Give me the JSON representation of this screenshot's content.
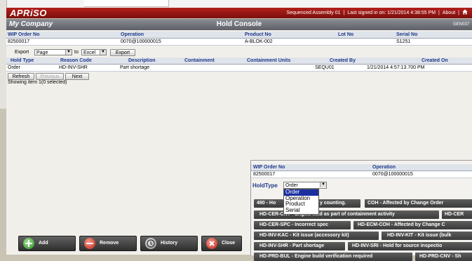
{
  "header": {
    "logo": "APRiSO",
    "station": "Sequenced Assembly 01",
    "last_signed": "Last signed in on: 1/21/2014 4:38:55 PM",
    "about": "About"
  },
  "titlebar": {
    "company": "My Company",
    "title": "Hold Console",
    "screen_code": "GEN037"
  },
  "grid1": {
    "headers": [
      "WIP Order No",
      "Operation",
      "Product No",
      "Lot No",
      "Serial No"
    ],
    "row": [
      "82500017",
      "0070@100000015",
      "A-BLOK-002",
      "",
      "S1251"
    ]
  },
  "export": {
    "label": "Export",
    "scope": "Page",
    "to": "to",
    "format": "Excel",
    "button": "Export"
  },
  "grid2": {
    "headers": [
      "Hold Type",
      "Reason Code",
      "Description",
      "Containment",
      "Containment Units",
      "Created By",
      "Created On"
    ],
    "row": [
      "Order",
      "HD-INV-SHR",
      "Part shortage",
      "",
      "",
      "SEQU01",
      "1/21/2014 4:57:13.700 PM"
    ]
  },
  "pager": {
    "refresh": "Refresh",
    "previous": "Previous",
    "next": "Next",
    "showing": "Showing item 1(0 selected)"
  },
  "bottom_buttons": {
    "add": "Add",
    "remove": "Remove",
    "history": "History",
    "close": "Close"
  },
  "popup": {
    "headers": [
      "WIP Order No",
      "Operation"
    ],
    "row": [
      "82500017",
      "0070@100000015"
    ],
    "holdtype_label": "HoldType",
    "holdtype_value": "Order",
    "holdtype_options": [
      "Order",
      "Operation",
      "Product",
      "Serial"
    ],
    "reason_chips": [
      [
        "490 - Ho",
        "y counting.",
        "COH - Affected by Change Order"
      ],
      [
        "HD-CER-CNT - Engine held as part of containment activity",
        "HD-CER"
      ],
      [
        "HD-CER-SPC - Incorrect spec",
        "HD-ECM-COH - Affected by Change C"
      ],
      [
        "HD-INV-KAC - Kit issue (accessory kit)",
        "HD-INV-KIT - Kit issue (bulk"
      ],
      [
        "HD-INV-SHR - Part shortage",
        "HD-INV-SRI - Hold for source inspectio"
      ],
      [
        "HD-PRD-BUL - Engine build verification required",
        "HD-PRD-CNV - Sh"
      ]
    ]
  },
  "colors": {
    "header_red": "#a11a16",
    "title_gray": "#6f737a",
    "selected_option": "#1a2fa0",
    "header_text_blue": "#1e3a8a"
  }
}
